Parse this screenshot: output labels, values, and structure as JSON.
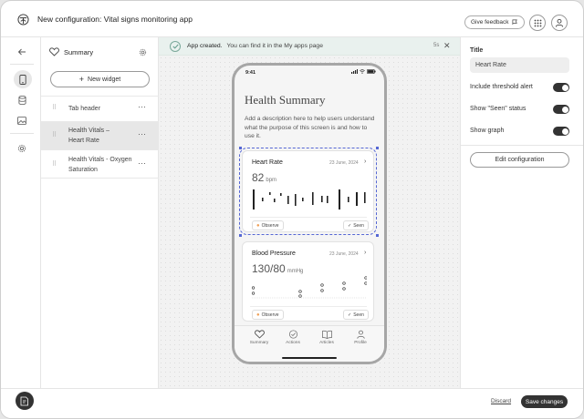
{
  "header": {
    "title": "New configuration: Vital signs monitoring app",
    "feedback_label": "Give feedback"
  },
  "rail": {
    "icons": [
      "back-arrow-icon",
      "phone-icon",
      "database-icon",
      "image-icon",
      "gear-icon"
    ]
  },
  "screens_panel": {
    "title": "Summary",
    "new_widget_label": "New widget",
    "items": [
      {
        "label": "Tab header",
        "selected": false
      },
      {
        "label": "Health Vitals – Heart Rate",
        "selected": true
      },
      {
        "label": "Health Vitals - Oxygen Saturation",
        "selected": false
      }
    ]
  },
  "toast": {
    "title": "App created.",
    "message": "You can find it in the My apps page",
    "timer": "5s"
  },
  "phone": {
    "time": "9:41",
    "title": "Health Summary",
    "description": "Add a description here to help users understand what the purpose of this screen is and how to use it.",
    "cards": [
      {
        "title": "Heart Rate",
        "date": "23 June, 2024",
        "value": "82",
        "unit": "bpm",
        "chip_observe": "Observe",
        "chip_seen": "Seen"
      },
      {
        "title": "Blood Pressure",
        "date": "23 June, 2024",
        "value": "130/80",
        "unit": "mmHg",
        "chip_observe": "Observe",
        "chip_seen": "Seen"
      }
    ],
    "tabs": [
      "Summary",
      "Actions",
      "Articles",
      "Profile"
    ]
  },
  "properties": {
    "title_label": "Title",
    "title_value": "Heart Rate",
    "toggles": [
      {
        "label": "Include threshold alert",
        "on": true
      },
      {
        "label": "Show \"Seen\" status",
        "on": true
      },
      {
        "label": "Show graph",
        "on": true
      }
    ],
    "edit_label": "Edit configuration"
  },
  "footer": {
    "discard_label": "Discard",
    "save_label": "Save changes"
  },
  "colors": {
    "accent_dark": "#333333",
    "toast_bg": "#e9f1ee",
    "selection": "#5567d4",
    "observe_dot": "#f0a057"
  }
}
